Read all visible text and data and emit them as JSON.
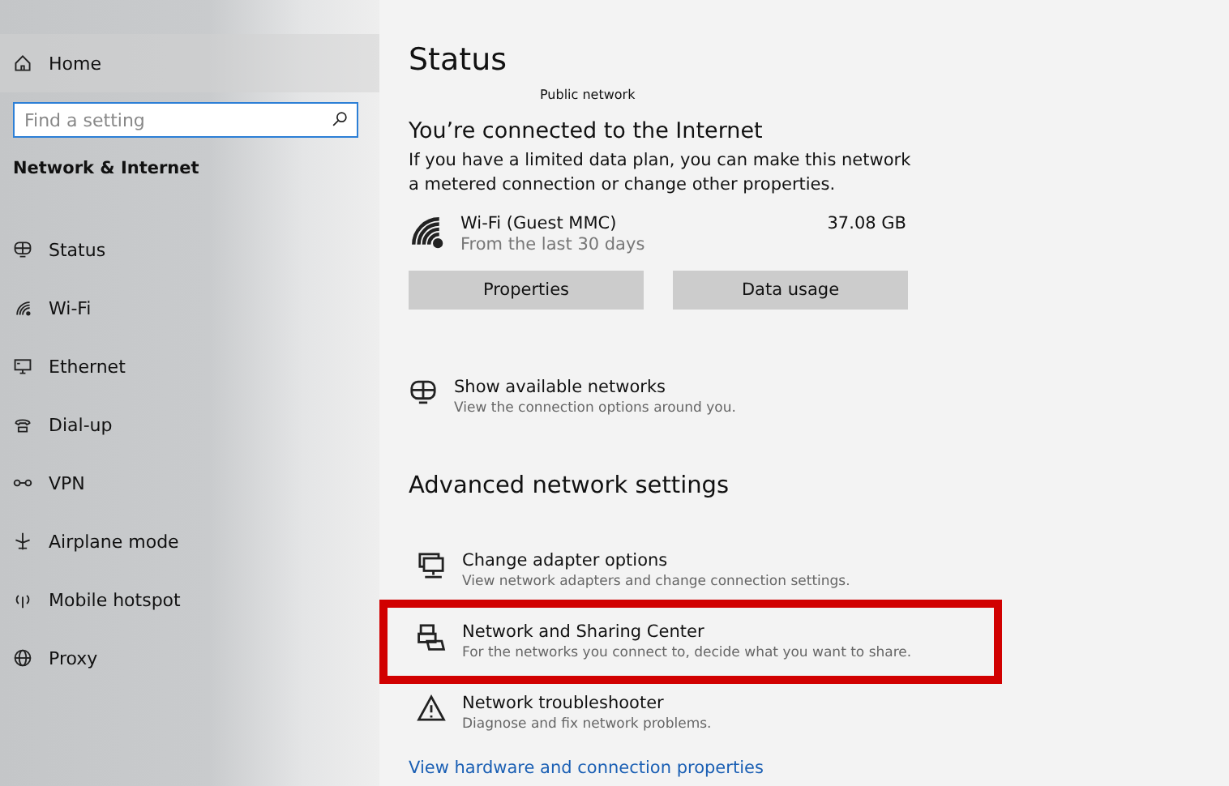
{
  "sidebar": {
    "home": "Home",
    "search": {
      "placeholder": "Find a setting"
    },
    "section_title": "Network & Internet",
    "items": [
      {
        "label": "Status",
        "selected": false
      },
      {
        "label": "Wi-Fi",
        "selected": false
      },
      {
        "label": "Ethernet",
        "selected": false
      },
      {
        "label": "Dial-up",
        "selected": false
      },
      {
        "label": "VPN",
        "selected": false
      },
      {
        "label": "Airplane mode",
        "selected": false
      },
      {
        "label": "Mobile hotspot",
        "selected": false
      },
      {
        "label": "Proxy",
        "selected": false
      }
    ]
  },
  "main": {
    "title": "Status",
    "network_type": "Public network",
    "heading": "You’re connected to the Internet",
    "description": "If you have a limited data plan, you can make this network a metered connection or change other properties.",
    "connection": {
      "name": "Wi-Fi (Guest MMC)",
      "period": "From the last 30 days",
      "usage": "37.08 GB"
    },
    "buttons": [
      "Properties",
      "Data usage"
    ],
    "show_networks": {
      "title": "Show available networks",
      "subtitle": "View the connection options around you."
    },
    "advanced_heading": "Advanced network settings",
    "advanced_items": [
      {
        "title": "Change adapter options",
        "subtitle": "View network adapters and change connection settings.",
        "highlighted": false
      },
      {
        "title": "Network and Sharing Center",
        "subtitle": "For the networks you connect to, decide what you want to share.",
        "highlighted": true
      },
      {
        "title": "Network troubleshooter",
        "subtitle": "Diagnose and fix network problems.",
        "highlighted": false
      }
    ],
    "link": "View hardware and connection properties"
  }
}
